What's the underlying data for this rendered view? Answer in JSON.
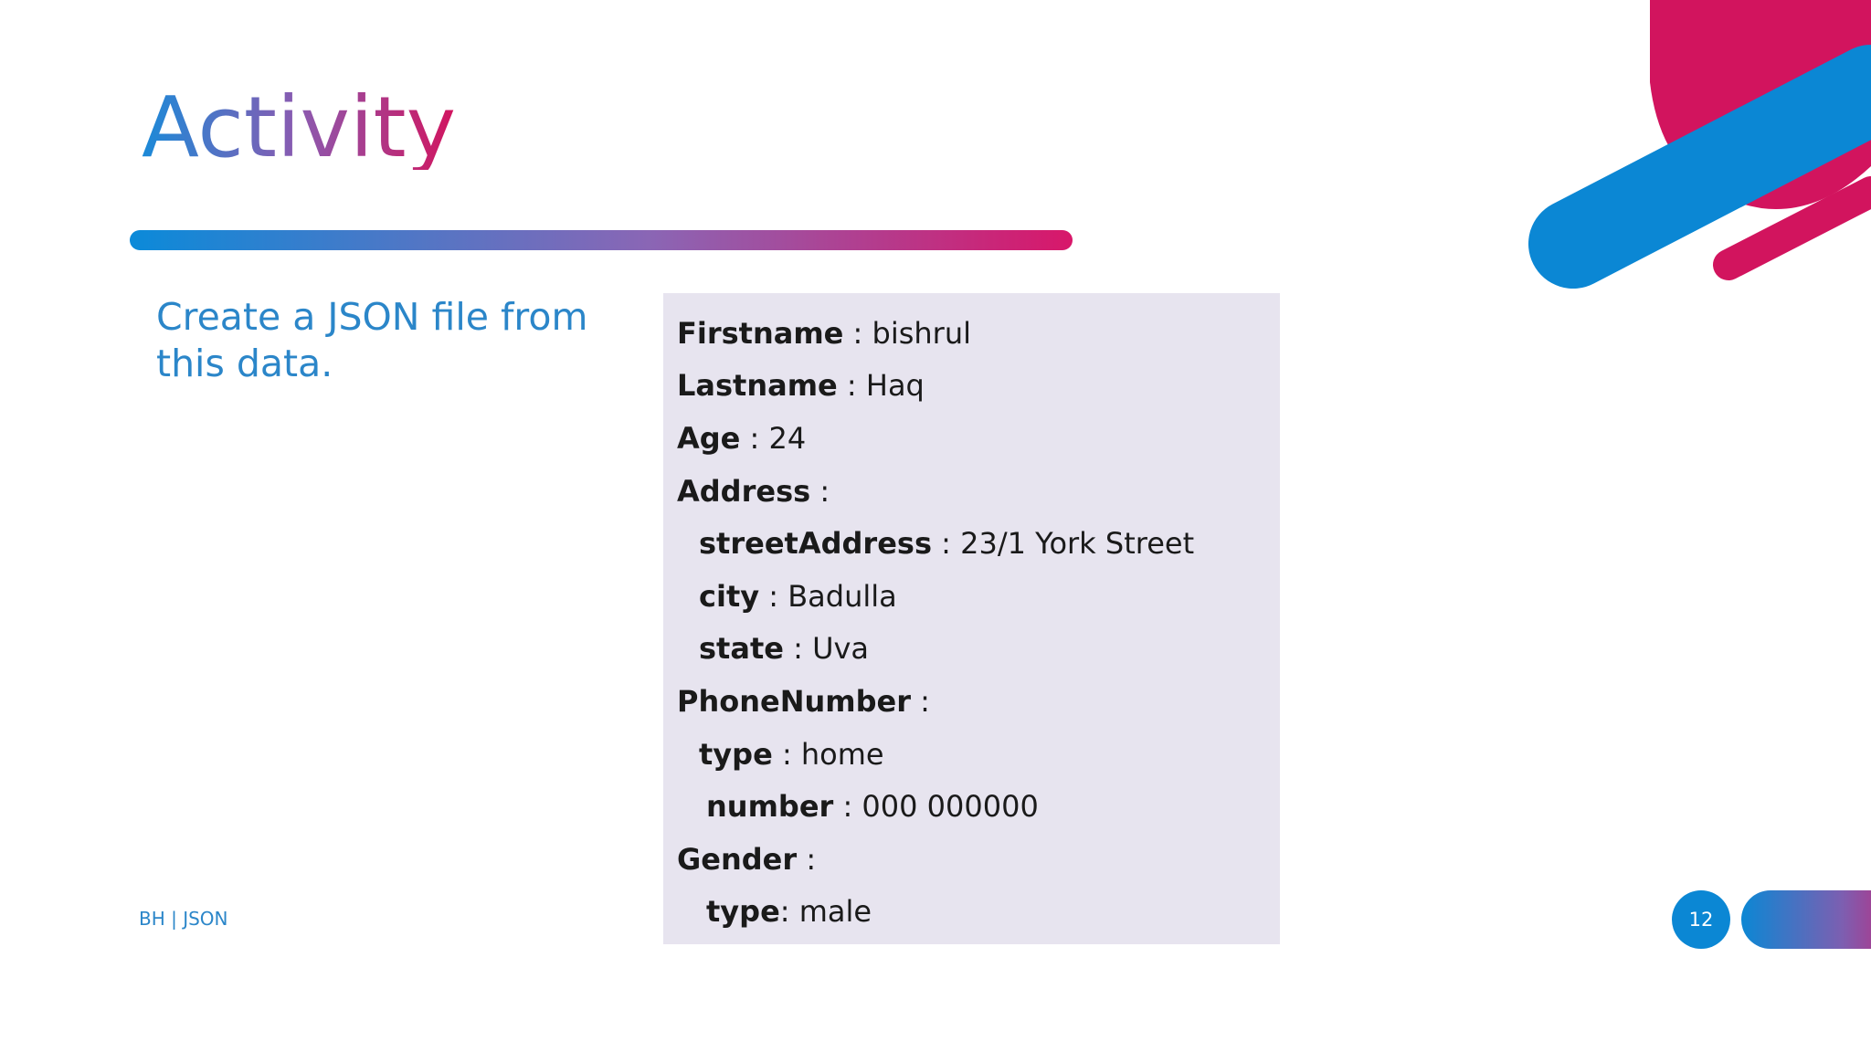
{
  "slide": {
    "title": "Activity",
    "instruction": "Create a JSON file from this data.",
    "footer_label": "BH | JSON",
    "page_number": "12"
  },
  "data_rows": [
    {
      "key": "Firstname",
      "sep": " : ",
      "value": "bishrul",
      "indent": 0
    },
    {
      "key": "Lastname",
      "sep": " : ",
      "value": "Haq",
      "indent": 0
    },
    {
      "key": "Age",
      "sep": " : ",
      "value": "24",
      "indent": 0
    },
    {
      "key": "Address",
      "sep": " :",
      "value": "",
      "indent": 0
    },
    {
      "key": "streetAddress",
      "sep": " : ",
      "value": "23/1 York Street",
      "indent": 24
    },
    {
      "key": "city",
      "sep": " : ",
      "value": "Badulla",
      "indent": 24
    },
    {
      "key": "state",
      "sep": " : ",
      "value": "Uva",
      "indent": 24
    },
    {
      "key": "PhoneNumber",
      "sep": " :",
      "value": "",
      "indent": 0
    },
    {
      "key": "type",
      "sep": " : ",
      "value": "home",
      "indent": 24
    },
    {
      "key": "number",
      "sep": " : ",
      "value": "000 000000",
      "indent": 32
    },
    {
      "key": "Gender",
      "sep": " :",
      "value": "",
      "indent": 0
    },
    {
      "key": "type",
      "sep": ": ",
      "value": "male",
      "indent": 32
    }
  ],
  "colors": {
    "blue": "#0b87d4",
    "magenta": "#d2145e",
    "box_background": "#e7e4ef",
    "instruction_text": "#2b86c9"
  }
}
